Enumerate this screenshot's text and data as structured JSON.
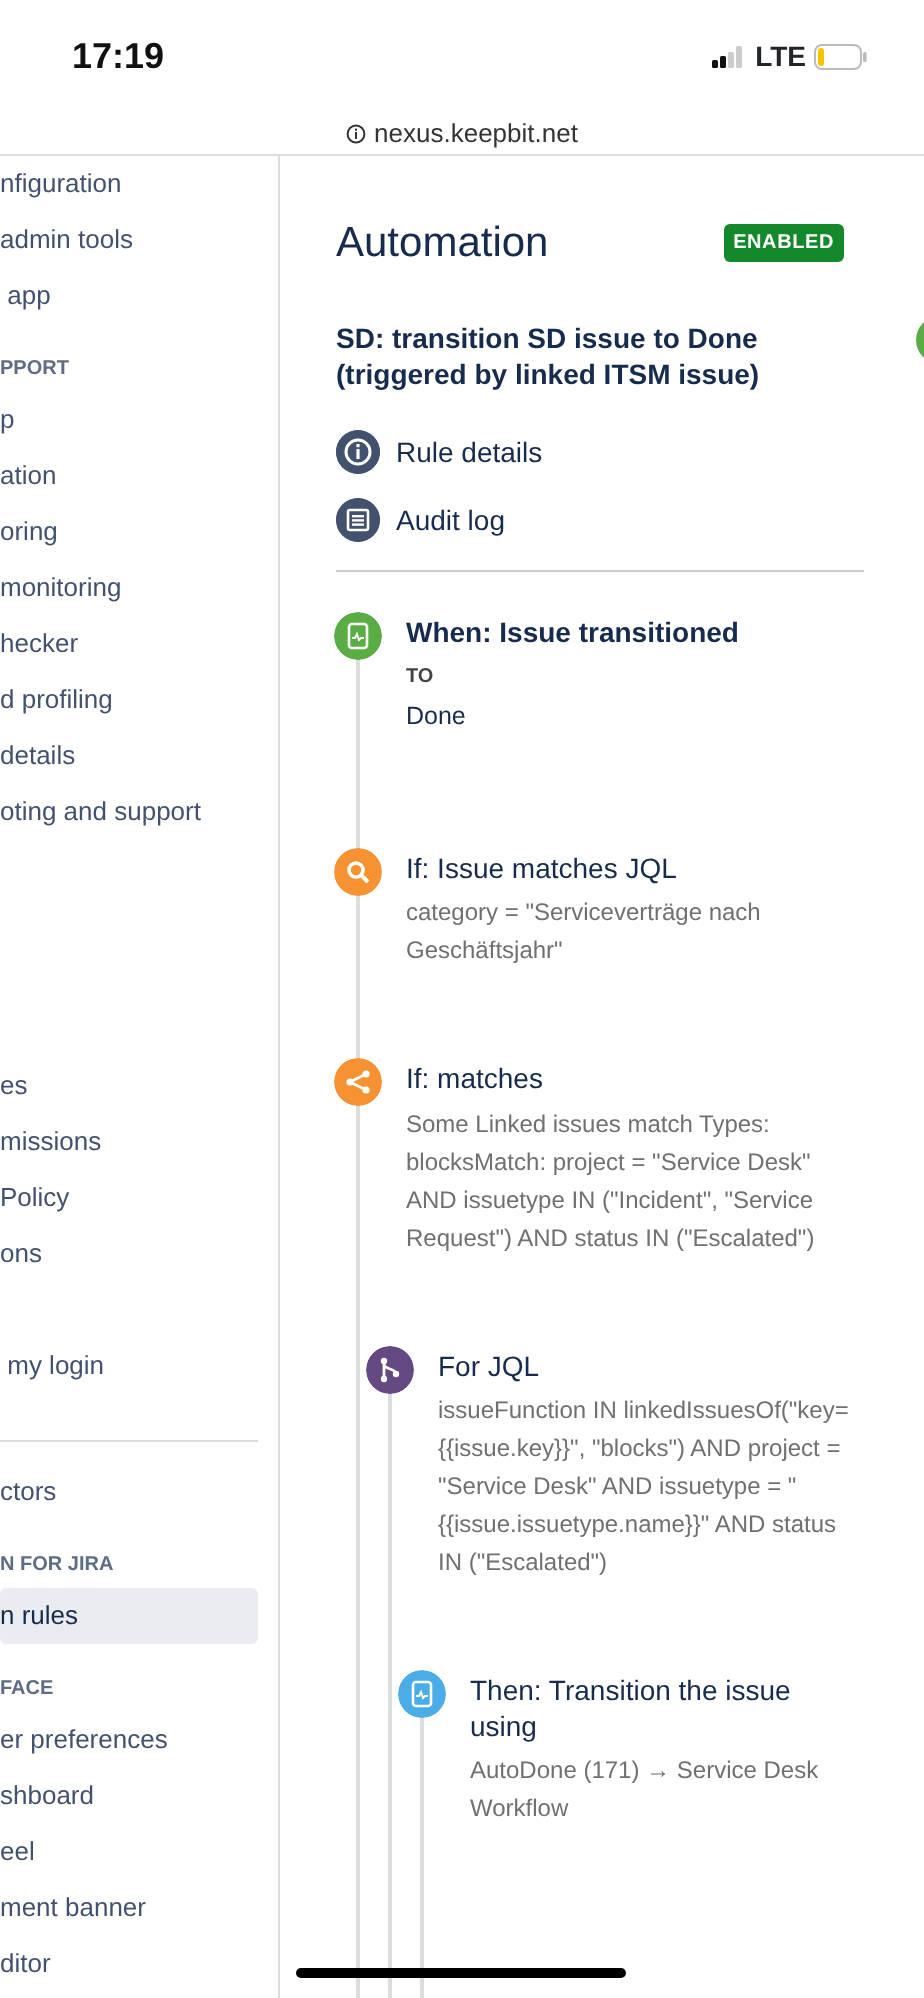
{
  "status_bar": {
    "time": "17:19",
    "network": "LTE"
  },
  "url_bar": {
    "address": "nexus.keepbit.net"
  },
  "sidebar": {
    "items": [
      {
        "kind": "link",
        "label": "nfiguration",
        "selected": false
      },
      {
        "kind": "link",
        "label": "admin tools",
        "selected": false
      },
      {
        "kind": "link",
        "label": " app",
        "selected": false
      },
      {
        "kind": "heading",
        "label": "PPORT"
      },
      {
        "kind": "link",
        "label": "p",
        "selected": false
      },
      {
        "kind": "link",
        "label": "ation",
        "selected": false
      },
      {
        "kind": "link",
        "label": "oring",
        "selected": false
      },
      {
        "kind": "link",
        "label": "monitoring",
        "selected": false
      },
      {
        "kind": "link",
        "label": "hecker",
        "selected": false
      },
      {
        "kind": "link",
        "label": "d profiling",
        "selected": false
      },
      {
        "kind": "link",
        "label": "details",
        "selected": false
      },
      {
        "kind": "link",
        "label": "oting and support",
        "selected": false
      },
      {
        "kind": "gap"
      },
      {
        "kind": "link",
        "label": "es",
        "selected": false
      },
      {
        "kind": "link",
        "label": "missions",
        "selected": false
      },
      {
        "kind": "link",
        "label": "Policy",
        "selected": false
      },
      {
        "kind": "link",
        "label": "ons",
        "selected": false
      },
      {
        "kind": "gap-small"
      },
      {
        "kind": "link",
        "label": " my login",
        "selected": false
      },
      {
        "kind": "divider"
      },
      {
        "kind": "link",
        "label": "ctors",
        "selected": false
      },
      {
        "kind": "heading",
        "label": "N FOR JIRA"
      },
      {
        "kind": "link",
        "label": "n rules",
        "selected": true
      },
      {
        "kind": "heading",
        "label": "FACE"
      },
      {
        "kind": "link",
        "label": "er preferences",
        "selected": false
      },
      {
        "kind": "link",
        "label": "shboard",
        "selected": false
      },
      {
        "kind": "link",
        "label": "eel",
        "selected": false
      },
      {
        "kind": "link",
        "label": "ment banner",
        "selected": false
      },
      {
        "kind": "link",
        "label": "ditor",
        "selected": false
      }
    ]
  },
  "main": {
    "title": "Automation",
    "status_badge": "ENABLED",
    "rule_name": "SD: transition SD issue to Done (triggered by linked ITSM issue)",
    "links": [
      {
        "kind": "info",
        "label": "Rule details"
      },
      {
        "kind": "log",
        "label": "Audit log"
      }
    ],
    "steps": [
      {
        "kind": "trigger",
        "color": "#5aac44",
        "title": "When: Issue transitioned",
        "field_label": "TO",
        "field_value": "Done"
      },
      {
        "kind": "search",
        "color": "#f79232",
        "title": "If: Issue matches JQL",
        "description": "category = \"Serviceverträge nach Geschäftsjahr\""
      },
      {
        "kind": "branch",
        "color": "#f79232",
        "title": "If: matches",
        "description": "Some Linked issues match Types: blocksMatch: project = \"Service Desk\" AND issuetype IN (\"Incident\", \"Service Request\") AND status IN (\"Escalated\")",
        "children": [
          {
            "kind": "fork",
            "color": "#654982",
            "title": "For JQL",
            "description": "issueFunction IN linkedIssuesOf(\"key={{issue.key}}\", \"blocks\") AND project = \"Service Desk\" AND issuetype = \"{{issue.issuetype.name}}\" AND status IN (\"Escalated\")",
            "children": [
              {
                "kind": "action",
                "color": "#4bade8",
                "title": "Then: Transition the issue using",
                "description": "AutoDone (171) → Service Desk Workflow"
              }
            ]
          }
        ]
      }
    ]
  }
}
